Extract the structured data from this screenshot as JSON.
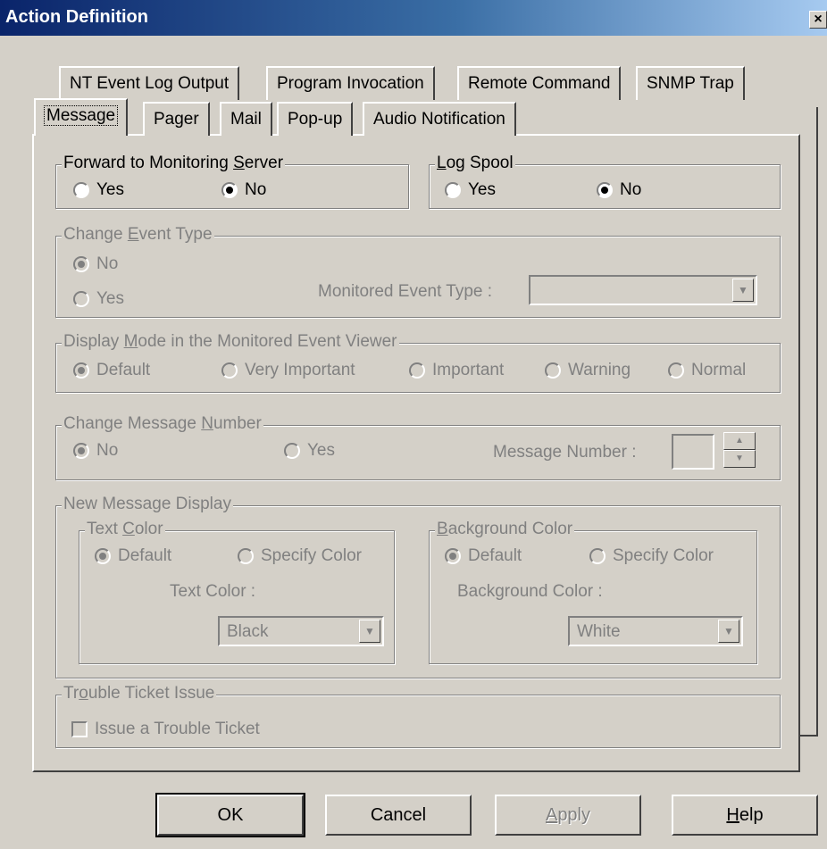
{
  "window": {
    "title": "Action Definition",
    "close_glyph": "×"
  },
  "tabs_back": [
    "NT Event Log Output",
    "Program Invocation",
    "Remote Command",
    "SNMP Trap"
  ],
  "tabs_front": [
    "Message",
    "Pager",
    "Mail",
    "Pop-up",
    "Audio Notification"
  ],
  "forward": {
    "legend_pre": "Forward to Monitoring ",
    "legend_u": "S",
    "legend_post": "erver",
    "yes": "Yes",
    "no": "No",
    "selected": "No"
  },
  "logspool": {
    "legend_pre": "",
    "legend_u": "L",
    "legend_post": "og Spool",
    "yes": "Yes",
    "no": "No",
    "selected": "No"
  },
  "change_event": {
    "legend_pre": "Change ",
    "legend_u": "E",
    "legend_post": "vent Type",
    "no": "No",
    "yes": "Yes",
    "selected": "No",
    "monitored_label": "Monitored Event Type :",
    "monitored_value": ""
  },
  "display_mode": {
    "legend_pre": "Display ",
    "legend_u": "M",
    "legend_post": "ode in the Monitored Event Viewer",
    "options": [
      "Default",
      "Very Important",
      "Important",
      "Warning",
      "Normal"
    ],
    "selected": "Default"
  },
  "change_msg": {
    "legend_pre": "Change Message ",
    "legend_u": "N",
    "legend_post": "umber",
    "no": "No",
    "yes": "Yes",
    "selected": "No",
    "number_label": "Message Number :",
    "number_value": ""
  },
  "new_msg": {
    "legend": "New Message Display",
    "text_color": {
      "legend_pre": "Text ",
      "legend_u": "C",
      "legend_post": "olor",
      "default": "Default",
      "specify": "Specify Color",
      "selected": "Default",
      "label": "Text Color :",
      "value": "Black"
    },
    "bg_color": {
      "legend_pre": "",
      "legend_u": "B",
      "legend_post": "ackground Color",
      "default": "Default",
      "specify": "Specify Color",
      "selected": "Default",
      "label": "Background Color :",
      "value": "White"
    }
  },
  "trouble": {
    "legend_pre": "Tr",
    "legend_u": "o",
    "legend_post": "uble Ticket Issue",
    "checkbox_label": "Issue a Trouble Ticket",
    "checked": false
  },
  "buttons": {
    "ok": "OK",
    "cancel": "Cancel",
    "apply_u": "A",
    "apply_rest": "pply",
    "help_u": "H",
    "help_rest": "elp"
  }
}
